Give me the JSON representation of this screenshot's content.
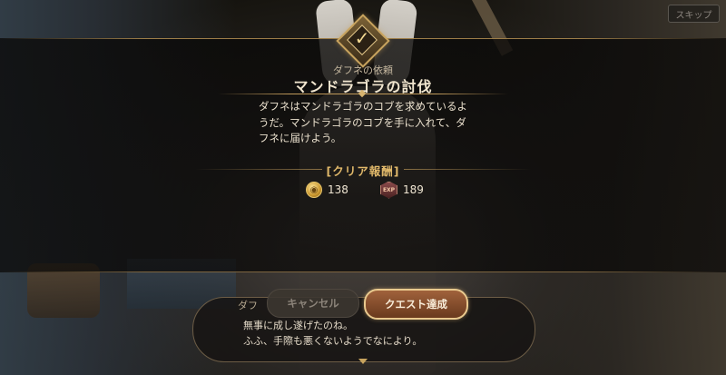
{
  "skip_label": "スキップ",
  "quest": {
    "giver": "ダフネの依頼",
    "title": "マンドラゴラの討伐",
    "description": "ダフネはマンドラゴラのコブを求めているようだ。マンドラゴラのコブを手に入れて、ダフネに届けよう。"
  },
  "rewards": {
    "title": "[クリア報酬]",
    "gold": "138",
    "exp": "189",
    "exp_icon_text": "EXP"
  },
  "buttons": {
    "cancel": "キャンセル",
    "accept": "クエスト達成"
  },
  "dialog": {
    "speaker": "ダフ",
    "line1": "無事に成し遂げたのね。",
    "line2": "ふふ、手際も悪くないようでなにより。"
  },
  "icons": {
    "emblem": "quest-check-emblem-icon",
    "gold": "gold-coin-icon",
    "exp": "exp-hexagon-icon",
    "more": "chevron-down-icon"
  },
  "colors": {
    "accent_gold": "#e0b86a",
    "accept_button": "#8a4e2c"
  }
}
